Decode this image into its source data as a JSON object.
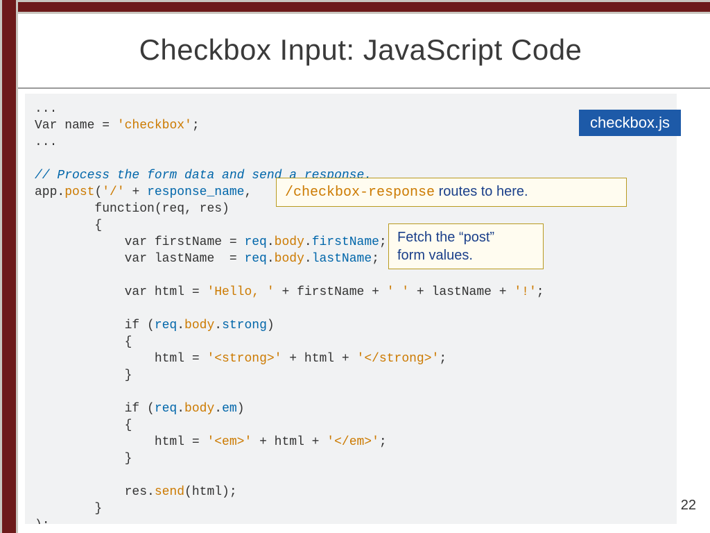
{
  "title": "Checkbox Input: JavaScript Code",
  "filename_badge": "checkbox.js",
  "callout_routes_pre": "/checkbox-response",
  "callout_routes_post": " routes to here.",
  "callout_fetch_line1": "Fetch the “post”",
  "callout_fetch_line2": "form values.",
  "page_number": "22",
  "code": {
    "l01": "...",
    "l02a": "Var name = ",
    "l02b": "'checkbox'",
    "l02c": ";",
    "l03": "...",
    "l05": "// Process the form data and send a response.",
    "l06a": "app.",
    "l06b": "post",
    "l06c": "(",
    "l06d": "'/'",
    "l06e": " + ",
    "l06f": "response_name",
    "l06g": ",",
    "l07": "        function(req, res)",
    "l08": "        {",
    "l09a": "            var firstName = ",
    "l09b": "req",
    "l09c": ".",
    "l09d": "body",
    "l09e": ".",
    "l09f": "firstName",
    "l09g": ";",
    "l10a": "            var lastName  = ",
    "l10b": "req",
    "l10c": ".",
    "l10d": "body",
    "l10e": ".",
    "l10f": "lastName",
    "l10g": ";",
    "l12a": "            var html = ",
    "l12b": "'Hello, '",
    "l12c": " + firstName + ",
    "l12d": "' '",
    "l12e": " + lastName + ",
    "l12f": "'!'",
    "l12g": ";",
    "l14a": "            if (",
    "l14b": "req",
    "l14c": ".",
    "l14d": "body",
    "l14e": ".",
    "l14f": "strong",
    "l14g": ")",
    "l15": "            {",
    "l16a": "                html = ",
    "l16b": "'<strong>'",
    "l16c": " + html + ",
    "l16d": "'</strong>'",
    "l16e": ";",
    "l17": "            }",
    "l19a": "            if (",
    "l19b": "req",
    "l19c": ".",
    "l19d": "body",
    "l19e": ".",
    "l19f": "em",
    "l19g": ")",
    "l20": "            {",
    "l21a": "                html = ",
    "l21b": "'<em>'",
    "l21c": " + html + ",
    "l21d": "'</em>'",
    "l21e": ";",
    "l22": "            }",
    "l24a": "            res.",
    "l24b": "send",
    "l24c": "(html);",
    "l25": "        }",
    "l26": ");"
  }
}
